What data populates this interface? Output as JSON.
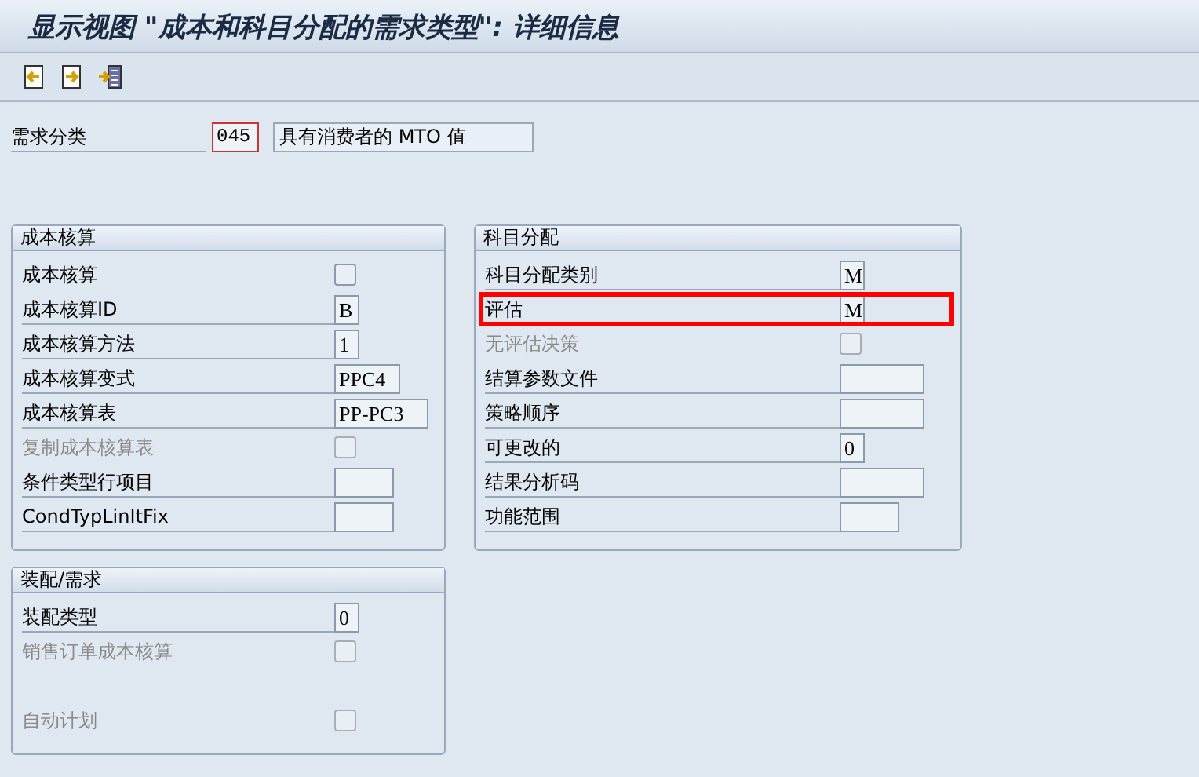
{
  "window": {
    "title": "显示视图 \"成本和科目分配的需求类型\": 详细信息"
  },
  "toolbar": [
    {
      "kind": "previous"
    },
    {
      "kind": "next"
    },
    {
      "kind": "select"
    }
  ],
  "requirements_class": {
    "label": "需求分类",
    "code": "045",
    "description": "具有消费者的 MTO 值"
  },
  "panels": [
    {
      "title": "成本核算",
      "rows": [
        {
          "label": "成本核算",
          "kind": "checkbox",
          "checked": false,
          "disabled": false
        },
        {
          "label": "成本核算ID",
          "kind": "field",
          "value": "B",
          "disabled": false
        },
        {
          "label": "成本核算方法",
          "kind": "field",
          "value": "1",
          "disabled": false
        },
        {
          "label": "成本核算变式",
          "kind": "field",
          "value": "PPC4",
          "disabled": false
        },
        {
          "label": "成本核算表",
          "kind": "field",
          "value": "PP-PC3",
          "disabled": false
        },
        {
          "label": "复制成本核算表",
          "kind": "checkbox",
          "checked": false,
          "disabled": true
        },
        {
          "label": "条件类型行项目",
          "kind": "field",
          "value": "",
          "disabled": false
        },
        {
          "label": "CondTypLinItFix",
          "kind": "field",
          "value": "",
          "disabled": false
        }
      ]
    },
    {
      "title": "科目分配",
      "rows": [
        {
          "label": "科目分配类别",
          "kind": "field",
          "value": "M",
          "disabled": false,
          "highlighted": false
        },
        {
          "label": "评估",
          "kind": "field",
          "value": "M",
          "disabled": false,
          "highlighted": true
        },
        {
          "label": "无评估决策",
          "kind": "checkbox",
          "checked": false,
          "disabled": true,
          "highlighted": false
        },
        {
          "label": "结算参数文件",
          "kind": "field",
          "value": "",
          "disabled": false,
          "highlighted": false
        },
        {
          "label": "策略顺序",
          "kind": "field",
          "value": "",
          "disabled": false,
          "highlighted": false
        },
        {
          "label": "可更改的",
          "kind": "field",
          "value": "0",
          "disabled": false,
          "highlighted": false
        },
        {
          "label": "结果分析码",
          "kind": "field",
          "value": "",
          "disabled": false,
          "highlighted": false
        },
        {
          "label": "功能范围",
          "kind": "field",
          "value": "",
          "disabled": false,
          "highlighted": false
        }
      ]
    },
    {
      "title": "装配/需求",
      "rows": [
        {
          "label": "装配类型",
          "kind": "field",
          "value": "0",
          "disabled": false
        },
        {
          "label": "销售订单成本核算",
          "kind": "checkbox",
          "checked": false,
          "disabled": true
        },
        {
          "label": "自动计划",
          "kind": "checkbox",
          "checked": false,
          "disabled": true
        }
      ]
    }
  ]
}
